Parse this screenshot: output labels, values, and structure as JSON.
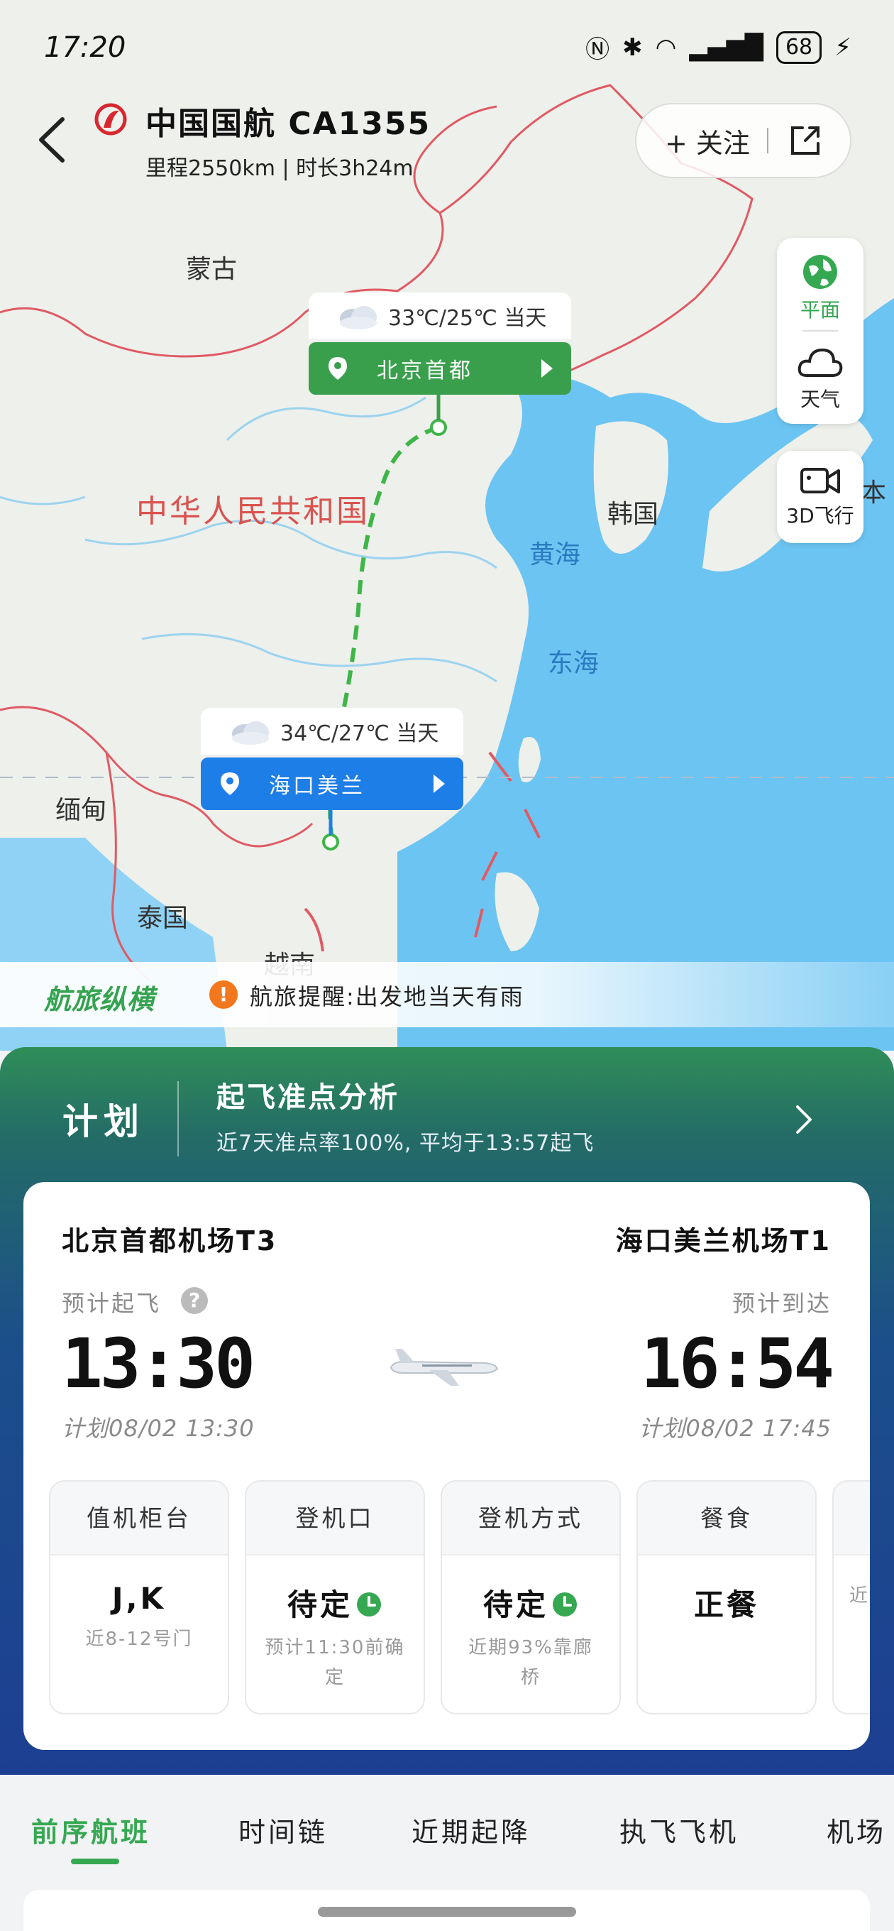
{
  "status_bar": {
    "time": "17:20",
    "battery": "68"
  },
  "header": {
    "flight_title": "中国国航 CA1355",
    "flight_meta": "里程2550km | 时长3h24m",
    "follow_label": "+ 关注"
  },
  "map": {
    "labels": {
      "mongolia": "蒙古",
      "china": "中华人民共和国",
      "korea": "韩国",
      "yellow_sea": "黄海",
      "east_sea": "东海",
      "myanmar": "缅甸",
      "thailand": "泰国",
      "vietnam": "越南",
      "japan_partial": "本"
    },
    "modes": {
      "flat": "平面",
      "weather": "天气",
      "flight3d": "3D飞行"
    }
  },
  "airports_on_map": {
    "departure": {
      "name": "北京首都",
      "weather": "33℃/25℃ 当天"
    },
    "arrival": {
      "name": "海口美兰",
      "weather": "34℃/27℃ 当天"
    }
  },
  "travel_tip": {
    "brand": "航旅纵横",
    "text": "航旅提醒:出发地当天有雨"
  },
  "plan": {
    "label": "计划",
    "ontime_title": "起飞准点分析",
    "ontime_sub": "近7天准点率100%, 平均于13:57起飞"
  },
  "flight_card": {
    "departure_airport": "北京首都机场T3",
    "arrival_airport": "海口美兰机场T1",
    "dep_est_label": "预计起飞",
    "arr_est_label": "预计到达",
    "dep_time": "13:30",
    "arr_time": "16:54",
    "dep_sched": "计划08/02 13:30",
    "arr_sched": "计划08/02 17:45"
  },
  "info_tiles": [
    {
      "head": "值机柜台",
      "value": "J,K",
      "note": "近8-12号门"
    },
    {
      "head": "登机口",
      "value": "待定",
      "note": "预计11:30前确定"
    },
    {
      "head": "登机方式",
      "value": "待定",
      "note": "近期93%靠廊桥"
    },
    {
      "head": "餐食",
      "value": "正餐",
      "note": ""
    },
    {
      "head": "",
      "value": "",
      "note": "近"
    }
  ],
  "tabs": [
    {
      "label": "前序航班",
      "active": true
    },
    {
      "label": "时间链",
      "active": false
    },
    {
      "label": "近期起降",
      "active": false
    },
    {
      "label": "执飞飞机",
      "active": false
    },
    {
      "label": "机场",
      "active": false
    }
  ],
  "colors": {
    "accent_green": "#36a852",
    "arrival_blue": "#1e7ee8",
    "warning_orange": "#f2771d"
  },
  "icons": [
    "back-arrow-icon",
    "air-china-logo",
    "share-icon",
    "globe-icon",
    "cloud-icon",
    "video-camera-icon",
    "location-pin-icon",
    "cloud-weather-icon",
    "warning-icon",
    "help-icon",
    "airplane-icon",
    "clock-icon",
    "chevron-right-icon"
  ]
}
